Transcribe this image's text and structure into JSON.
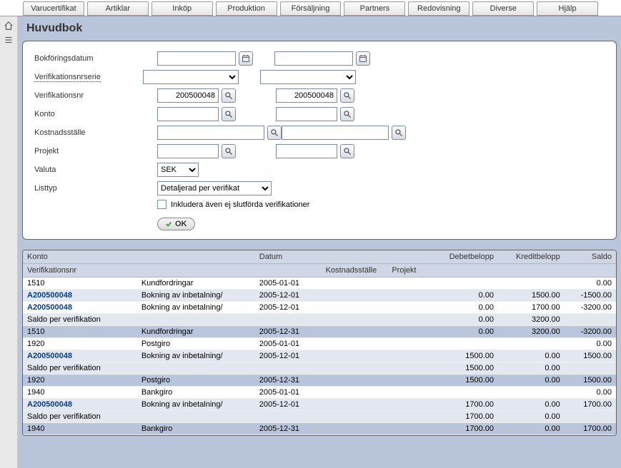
{
  "topMenu": [
    "Varucertifikat",
    "Artiklar",
    "Inköp",
    "Produktion",
    "Försäljning",
    "Partners",
    "Redovisning",
    "Diverse",
    "Hjälp"
  ],
  "page": {
    "title": "Huvudbok"
  },
  "form": {
    "labels": {
      "bokforingsdatum": "Bokföringsdatum",
      "verifikationsnrserie": "Verifikationsnrserie",
      "verifikationsnr": "Verifikationsnr",
      "konto": "Konto",
      "kostnadsstalle": "Kostnadsställe",
      "projekt": "Projekt",
      "valuta": "Valuta",
      "listtyp": "Listtyp",
      "inkludera": "Inkludera även ej slutförda verifikationer"
    },
    "values": {
      "verifikationsnr_from": "200500048",
      "verifikationsnr_to": "200500048",
      "valuta": "SEK",
      "listtyp": "Detaljerad per verifikat"
    },
    "ok": "OK"
  },
  "grid": {
    "headers": {
      "konto": "Konto",
      "datum": "Datum",
      "debetbelopp": "Debetbelopp",
      "kreditbelopp": "Kreditbelopp",
      "saldo": "Saldo",
      "verifikationsnr": "Verifikationsnr",
      "kostnadsstalle": "Kostnadsställe",
      "projekt": "Projekt"
    },
    "rows": [
      {
        "alt": false,
        "c": [
          "1510",
          "Kundfordringar",
          "2005-01-01",
          "",
          "",
          "",
          "",
          "0.00"
        ],
        "link": false
      },
      {
        "alt": true,
        "c": [
          "A200500048",
          "Bokning av inbetalning/",
          "2005-12-01",
          "",
          "",
          "0.00",
          "1500.00",
          "-1500.00"
        ],
        "link": true
      },
      {
        "alt": false,
        "c": [
          "A200500048",
          "Bokning av inbetalning/",
          "2005-12-01",
          "",
          "",
          "0.00",
          "1700.00",
          "-3200.00"
        ],
        "link": true
      },
      {
        "alt": true,
        "c": [
          "Saldo per verifikation",
          "",
          "",
          "",
          "",
          "0.00",
          "3200.00",
          ""
        ],
        "link": false
      },
      {
        "alt": true,
        "sel": true,
        "c": [
          "1510",
          "Kundfordringar",
          "2005-12-31",
          "",
          "",
          "0.00",
          "3200.00",
          "-3200.00"
        ],
        "link": false
      },
      {
        "alt": false,
        "c": [
          "1920",
          "Postgiro",
          "2005-01-01",
          "",
          "",
          "",
          "",
          "0.00"
        ],
        "link": false
      },
      {
        "alt": true,
        "c": [
          "A200500048",
          "Bokning av inbetalning/",
          "2005-12-01",
          "",
          "",
          "1500.00",
          "0.00",
          "1500.00"
        ],
        "link": true
      },
      {
        "alt": true,
        "c": [
          "Saldo per verifikation",
          "",
          "",
          "",
          "",
          "1500.00",
          "0.00",
          ""
        ],
        "link": false
      },
      {
        "alt": true,
        "sel": true,
        "c": [
          "1920",
          "Postgiro",
          "2005-12-31",
          "",
          "",
          "1500.00",
          "0.00",
          "1500.00"
        ],
        "link": false
      },
      {
        "alt": false,
        "c": [
          "1940",
          "Bankgiro",
          "2005-01-01",
          "",
          "",
          "",
          "",
          "0.00"
        ],
        "link": false
      },
      {
        "alt": true,
        "c": [
          "A200500048",
          "Bokning av inbetalning/",
          "2005-12-01",
          "",
          "",
          "1700.00",
          "0.00",
          "1700.00"
        ],
        "link": true
      },
      {
        "alt": true,
        "c": [
          "Saldo per verifikation",
          "",
          "",
          "",
          "",
          "1700.00",
          "0.00",
          ""
        ],
        "link": false
      },
      {
        "alt": true,
        "sel": true,
        "c": [
          "1940",
          "Bankgiro",
          "2005-12-31",
          "",
          "",
          "1700.00",
          "0.00",
          "1700.00"
        ],
        "link": false
      }
    ]
  }
}
